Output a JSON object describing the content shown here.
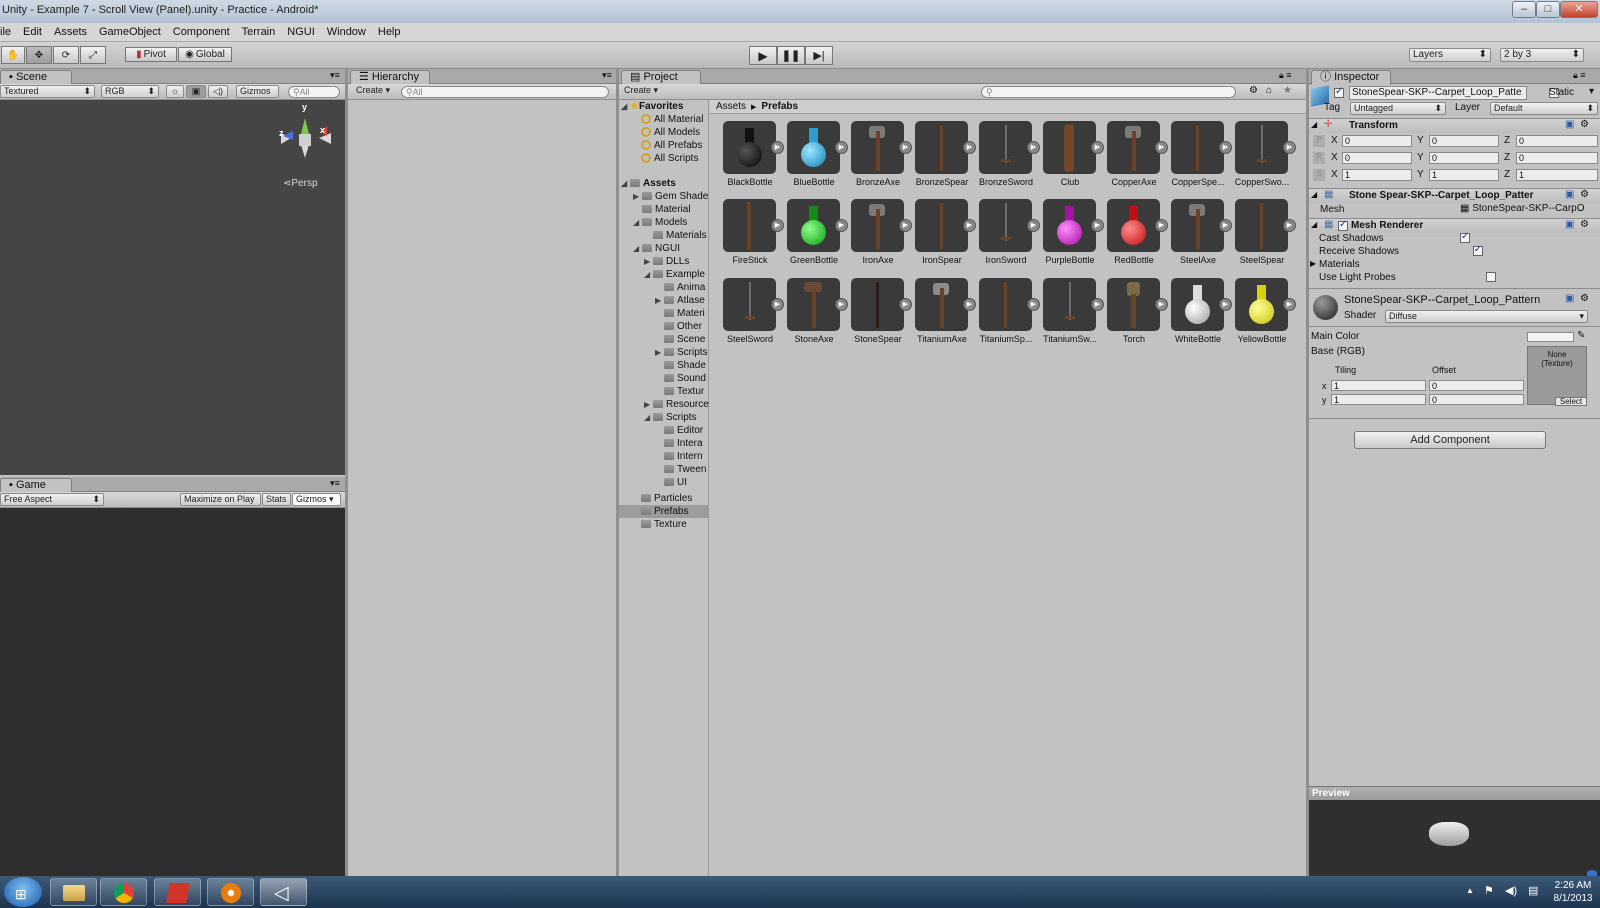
{
  "window": {
    "title": "Unity - Example 7 - Scroll View (Panel).unity - Practice - Android*"
  },
  "menu": [
    "ile",
    "Edit",
    "Assets",
    "GameObject",
    "Component",
    "Terrain",
    "NGUI",
    "Window",
    "Help"
  ],
  "toolbar": {
    "pivot": "Pivot",
    "global": "Global",
    "layers": "Layers",
    "layout": "2 by 3"
  },
  "scene": {
    "tab": "Scene",
    "shading": "Textured",
    "rgb": "RGB",
    "gizmos": "Gizmos",
    "search": "All",
    "persp": "Persp",
    "axis_y": "y",
    "axis_x": "x",
    "axis_z": "z"
  },
  "game": {
    "tab": "Game",
    "aspect": "Free Aspect",
    "maximize": "Maximize on Play",
    "stats": "Stats",
    "gizmos": "Gizmos"
  },
  "hierarchy": {
    "tab": "Hierarchy",
    "create": "Create",
    "search": "All"
  },
  "project": {
    "tab": "Project",
    "create": "Create",
    "breadcrumb": [
      "Assets",
      "Prefabs"
    ],
    "favorites_label": "Favorites",
    "favorites": [
      "All Material",
      "All Models",
      "All Prefabs",
      "All Scripts"
    ],
    "assets_label": "Assets",
    "tree": [
      "Gem Shade",
      "Material",
      "Models",
      "Materials",
      "NGUI",
      "DLLs",
      "Example",
      "Anima",
      "Atlase",
      "Materi",
      "Other",
      "Scene",
      "Scripts",
      "Shade",
      "Sound",
      "Textur",
      "Resource",
      "Scripts",
      "Editor",
      "Intera",
      "Intern",
      "Tween",
      "UI",
      "Particles",
      "Prefabs",
      "Texture"
    ],
    "items": [
      "BlackBottle",
      "BlueBottle",
      "BronzeAxe",
      "BronzeSpear",
      "BronzeSword",
      "Club",
      "CopperAxe",
      "CopperSpe...",
      "CopperSwo...",
      "FireStick",
      "GreenBottle",
      "IronAxe",
      "IronSpear",
      "IronSword",
      "PurpleBottle",
      "RedBottle",
      "SteelAxe",
      "SteelSpear",
      "SteelSword",
      "StoneAxe",
      "StoneSpear",
      "TitaniumAxe",
      "TitaniumSp...",
      "TitaniumSw...",
      "Torch",
      "WhiteBottle",
      "YellowBottle"
    ]
  },
  "inspector": {
    "tab": "Inspector",
    "object_name": "StoneSpear-SKP--Carpet_Loop_Patte",
    "static": "Static",
    "tag_label": "Tag",
    "tag": "Untagged",
    "layer_label": "Layer",
    "layer": "Default",
    "transform": "Transform",
    "pos": {
      "x": "0",
      "y": "0",
      "z": "0"
    },
    "rot": {
      "x": "0",
      "y": "0",
      "z": "0"
    },
    "scale": {
      "x": "1",
      "y": "1",
      "z": "1"
    },
    "axis_x": "X",
    "axis_y": "Y",
    "axis_z": "Z",
    "mesh_filter": "Stone Spear-SKP--Carpet_Loop_Patter",
    "mesh_label": "Mesh",
    "mesh_value": "StoneSpear-SKP--CarpO",
    "mesh_renderer": "Mesh Renderer",
    "cast_shadows": "Cast Shadows",
    "receive_shadows": "Receive Shadows",
    "materials": "Materials",
    "use_light_probes": "Use Light Probes",
    "material_name": "StoneSpear-SKP--Carpet_Loop_Pattern",
    "shader_label": "Shader",
    "shader": "Diffuse",
    "main_color": "Main Color",
    "base": "Base (RGB)",
    "tiling": "Tiling",
    "offset": "Offset",
    "tile_x": "1",
    "tile_y": "1",
    "off_x": "0",
    "off_y": "0",
    "row_x": "x",
    "row_y": "y",
    "texture_none": "None\n(Texture)",
    "select": "Select",
    "add_component": "Add Component",
    "preview": "Preview"
  },
  "taskbar": {
    "time": "2:26 AM",
    "date": "8/1/2013"
  }
}
